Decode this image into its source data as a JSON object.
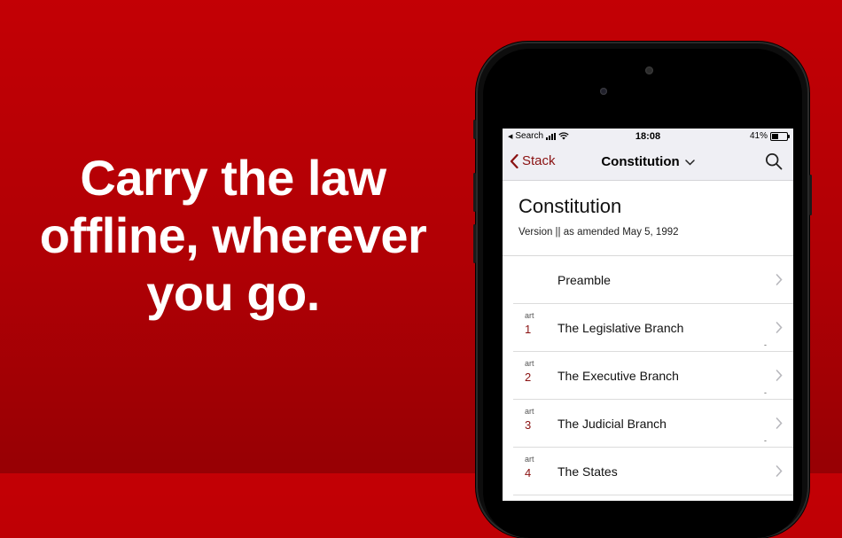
{
  "headline": [
    "Carry the law",
    "offline, wherever",
    "you go."
  ],
  "status": {
    "back_label": "Search",
    "time": "18:08",
    "battery": "41%",
    "battery_level": 0.41
  },
  "nav": {
    "back": "Stack",
    "title": "Constitution"
  },
  "document": {
    "title": "Constitution",
    "version": "Version || as amended May 5, 1992"
  },
  "items": [
    {
      "kind": "",
      "number": "",
      "label": "Preamble",
      "dash": ""
    },
    {
      "kind": "art",
      "number": "1",
      "label": "The Legislative Branch",
      "dash": "-"
    },
    {
      "kind": "art",
      "number": "2",
      "label": "The Executive Branch",
      "dash": "-"
    },
    {
      "kind": "art",
      "number": "3",
      "label": "The Judicial Branch",
      "dash": "-"
    },
    {
      "kind": "art",
      "number": "4",
      "label": "The States",
      "dash": ""
    }
  ],
  "colors": {
    "background": "#c30005",
    "accent": "#8a1212"
  },
  "icons": {
    "back": "chevron-left-icon",
    "title_menu": "chevron-down-icon",
    "search": "search-icon",
    "row": "chevron-right-icon"
  }
}
